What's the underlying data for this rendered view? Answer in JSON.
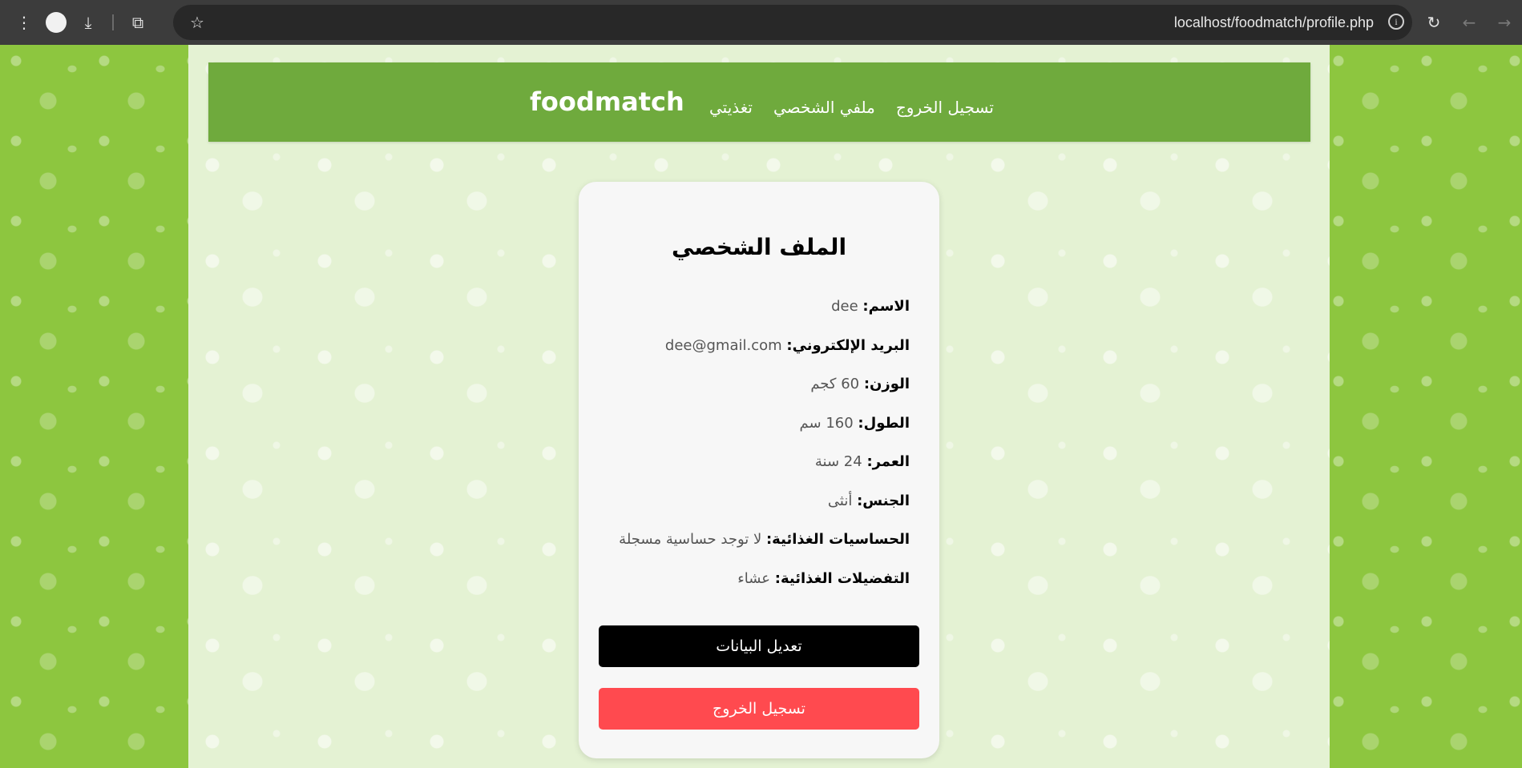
{
  "browser": {
    "url": "localhost/foodmatch/profile.php",
    "icons": [
      "more-vert-icon",
      "avatar-icon",
      "download-icon",
      "extensions-icon",
      "star-icon",
      "site-info-icon",
      "reload-icon",
      "back-icon",
      "forward-icon"
    ]
  },
  "header": {
    "brand": "foodmatch",
    "menu": [
      {
        "label": "تسجيل الخروج"
      },
      {
        "label": "ملفي الشخصي"
      },
      {
        "label": "تغذيتي"
      }
    ]
  },
  "profile": {
    "title": "الملف الشخصي",
    "fields": [
      {
        "label": "الاسم:",
        "value": "dee"
      },
      {
        "label": "البريد الإلكتروني:",
        "value": "dee@gmail.com"
      },
      {
        "label": "الوزن:",
        "value": "60 كجم"
      },
      {
        "label": "الطول:",
        "value": "160 سم"
      },
      {
        "label": "العمر:",
        "value": "24 سنة"
      },
      {
        "label": "الجنس:",
        "value": "أنثى"
      },
      {
        "label": "الحساسيات الغذائية:",
        "value": "لا توجد حساسية مسجلة"
      },
      {
        "label": "التفضيلات الغذائية:",
        "value": "عشاء"
      }
    ],
    "edit_button": "تعديل البيانات",
    "logout_button": "تسجيل الخروج"
  },
  "colors": {
    "header_green": "#6faa3d",
    "page_green": "#8dc63f",
    "logout_red": "#ff4a4f",
    "edit_black": "#000000"
  }
}
